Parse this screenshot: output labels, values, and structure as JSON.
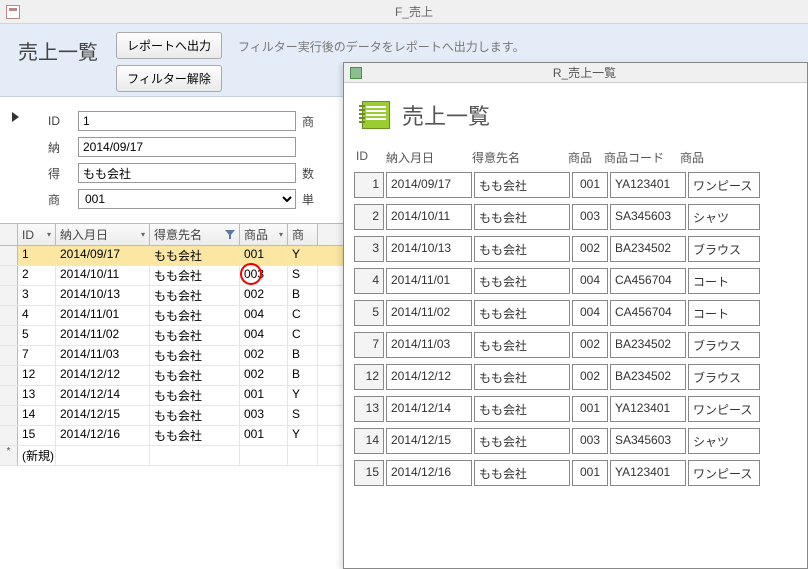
{
  "window": {
    "title": "F_売上"
  },
  "form": {
    "heading": "売上一覧",
    "btn_report": "レポートへ出力",
    "btn_clear": "フィルター解除",
    "help": "フィルター実行後のデータをレポートへ出力します。",
    "labels": {
      "id": "ID",
      "nounyu": "納",
      "tokui": "得",
      "shohin": "商",
      "suuryou": "数",
      "tanka": "単",
      "shouhin2": "商"
    },
    "values": {
      "id": "1",
      "nounyu": "2014/09/17",
      "tokui": "もも会社",
      "shohin": "001"
    }
  },
  "datasheet": {
    "headers": {
      "id": "ID",
      "date": "納入月日",
      "cust": "得意先名",
      "shohin": "商品",
      "rest": "商"
    },
    "new_row": "(新規)",
    "rows": [
      {
        "id": "1",
        "date": "2014/09/17",
        "cust": "もも会社",
        "shohin": "001",
        "rest": "Y"
      },
      {
        "id": "2",
        "date": "2014/10/11",
        "cust": "もも会社",
        "shohin": "003",
        "rest": "S"
      },
      {
        "id": "3",
        "date": "2014/10/13",
        "cust": "もも会社",
        "shohin": "002",
        "rest": "B"
      },
      {
        "id": "4",
        "date": "2014/11/01",
        "cust": "もも会社",
        "shohin": "004",
        "rest": "C"
      },
      {
        "id": "5",
        "date": "2014/11/02",
        "cust": "もも会社",
        "shohin": "004",
        "rest": "C"
      },
      {
        "id": "7",
        "date": "2014/11/03",
        "cust": "もも会社",
        "shohin": "002",
        "rest": "B"
      },
      {
        "id": "12",
        "date": "2014/12/12",
        "cust": "もも会社",
        "shohin": "002",
        "rest": "B"
      },
      {
        "id": "13",
        "date": "2014/12/14",
        "cust": "もも会社",
        "shohin": "001",
        "rest": "Y"
      },
      {
        "id": "14",
        "date": "2014/12/15",
        "cust": "もも会社",
        "shohin": "003",
        "rest": "S"
      },
      {
        "id": "15",
        "date": "2014/12/16",
        "cust": "もも会社",
        "shohin": "001",
        "rest": "Y"
      }
    ]
  },
  "report": {
    "title": "R_売上一覧",
    "heading": "売上一覧",
    "cols": {
      "id": "ID",
      "date": "納入月日",
      "cust": "得意先名",
      "sh": "商品",
      "cd": "商品コード",
      "name": "商品"
    },
    "rows": [
      {
        "id": "1",
        "date": "2014/09/17",
        "cust": "もも会社",
        "sh": "001",
        "cd": "YA123401",
        "name": "ワンピース"
      },
      {
        "id": "2",
        "date": "2014/10/11",
        "cust": "もも会社",
        "sh": "003",
        "cd": "SA345603",
        "name": "シャツ"
      },
      {
        "id": "3",
        "date": "2014/10/13",
        "cust": "もも会社",
        "sh": "002",
        "cd": "BA234502",
        "name": "ブラウス"
      },
      {
        "id": "4",
        "date": "2014/11/01",
        "cust": "もも会社",
        "sh": "004",
        "cd": "CA456704",
        "name": "コート"
      },
      {
        "id": "5",
        "date": "2014/11/02",
        "cust": "もも会社",
        "sh": "004",
        "cd": "CA456704",
        "name": "コート"
      },
      {
        "id": "7",
        "date": "2014/11/03",
        "cust": "もも会社",
        "sh": "002",
        "cd": "BA234502",
        "name": "ブラウス"
      },
      {
        "id": "12",
        "date": "2014/12/12",
        "cust": "もも会社",
        "sh": "002",
        "cd": "BA234502",
        "name": "ブラウス"
      },
      {
        "id": "13",
        "date": "2014/12/14",
        "cust": "もも会社",
        "sh": "001",
        "cd": "YA123401",
        "name": "ワンピース"
      },
      {
        "id": "14",
        "date": "2014/12/15",
        "cust": "もも会社",
        "sh": "003",
        "cd": "SA345603",
        "name": "シャツ"
      },
      {
        "id": "15",
        "date": "2014/12/16",
        "cust": "もも会社",
        "sh": "001",
        "cd": "YA123401",
        "name": "ワンピース"
      }
    ]
  }
}
